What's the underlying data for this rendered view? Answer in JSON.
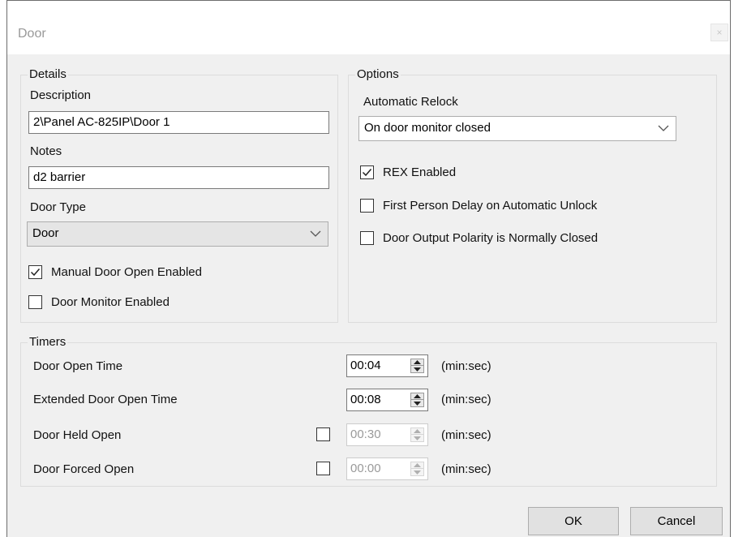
{
  "window": {
    "title": "Door",
    "close_glyph": "×"
  },
  "details": {
    "group_label": "Details",
    "description_label": "Description",
    "description_value": "2\\Panel  AC-825IP\\Door 1",
    "notes_label": "Notes",
    "notes_value": "d2 barrier",
    "door_type_label": "Door Type",
    "door_type_value": "Door",
    "manual_door_open_label": "Manual Door Open Enabled",
    "manual_door_open_checked": true,
    "door_monitor_label": "Door Monitor Enabled",
    "door_monitor_checked": false
  },
  "options": {
    "group_label": "Options",
    "automatic_relock_label": "Automatic Relock",
    "automatic_relock_value": "On door monitor closed",
    "rex_label": "REX Enabled",
    "rex_checked": true,
    "first_person_label": "First Person Delay on Automatic Unlock",
    "first_person_checked": false,
    "polarity_label": "Door Output Polarity is Normally Closed",
    "polarity_checked": false
  },
  "timers": {
    "group_label": "Timers",
    "rows": [
      {
        "label": "Door Open Time",
        "value": "00:04",
        "unit": "(min:sec)",
        "enabled": true,
        "has_checkbox": false
      },
      {
        "label": "Extended Door Open Time",
        "value": "00:08",
        "unit": "(min:sec)",
        "enabled": true,
        "has_checkbox": false
      },
      {
        "label": "Door Held Open",
        "value": "00:30",
        "unit": "(min:sec)",
        "enabled": false,
        "has_checkbox": true,
        "checked": false
      },
      {
        "label": "Door Forced Open",
        "value": "00:00",
        "unit": "(min:sec)",
        "enabled": false,
        "has_checkbox": true,
        "checked": false
      }
    ]
  },
  "buttons": {
    "ok": "OK",
    "cancel": "Cancel"
  },
  "icons": {
    "close": "close-icon",
    "chevron": "chevron-down-icon",
    "check": "checkmark-icon",
    "spin": "spin-arrows-icon"
  }
}
